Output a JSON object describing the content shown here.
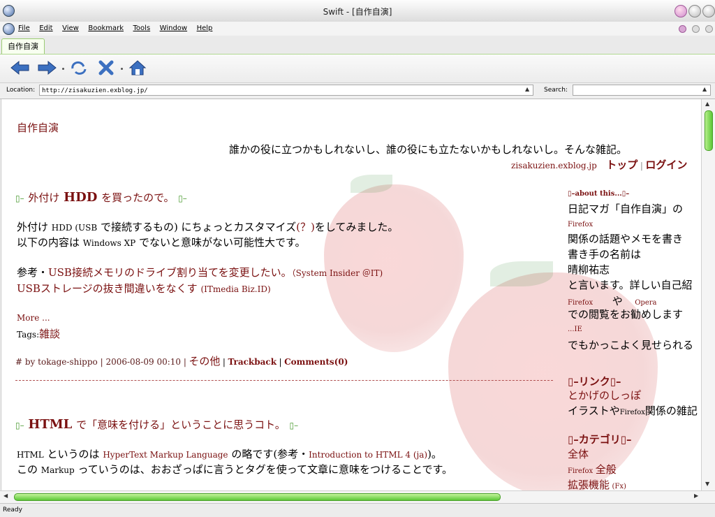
{
  "window": {
    "title": "Swift - [自作自演]"
  },
  "menu": [
    "File",
    "Edit",
    "View",
    "Bookmark",
    "Tools",
    "Window",
    "Help"
  ],
  "tabs": [
    {
      "label": "自作自演"
    }
  ],
  "location": {
    "label": "Location:",
    "value": "http://zisakuzien.exblog.jp/",
    "search_label": "Search:",
    "search_value": ""
  },
  "status": "Ready",
  "page": {
    "blog_title": "自作自演",
    "tagline": "誰かの役に立つかもしれないし、誰の役にも立たないかもしれないし。そんな雑記。",
    "domain": "zisakuzien.exblog.jp",
    "top_link": "トップ",
    "sep": "|",
    "login_link": "ログイン"
  },
  "post1": {
    "glyph_l": "▯–",
    "title_pre": "外付け",
    "title_bold": "HDD",
    "title_post": "を買ったので。",
    "glyph_r": "▯–",
    "line1_a": "外付け",
    "line1_b": "HDD (USB",
    "line1_c": "で接続するもの) にちょっとカスタマイズ",
    "line1_d": "(？)",
    "line1_e": "をしてみました。",
    "line2_a": "以下の内容は",
    "line2_b": "Windows XP",
    "line2_c": "でないと意味がない可能性大です。",
    "ref_label": "参考・",
    "ref1_a": "USB接続メモリのドライブ割り当てを変更したい。",
    "ref1_b": "（System Insider ＠IT)",
    "ref2_a": "USBストレージの抜き間違いをなくす",
    "ref2_b": "(ITmedia Biz.ID)",
    "more": "More ...",
    "tags_label": "Tags:",
    "tag": "雑談",
    "meta_by": "# by tokage-shippo | 2006-08-09 00:10 |",
    "meta_cat": "その他",
    "meta_sep1": "|",
    "trackback": "Trackback",
    "meta_sep2": "|",
    "comments": "Comments(0)"
  },
  "post2": {
    "glyph_l": "▯–",
    "title_bold": "HTML",
    "title_post": "で「意味を付ける」ということに思うコト。",
    "glyph_r": "▯–",
    "line1_a": "HTML",
    "line1_b": "というのは",
    "line1_c": "HyperText Markup Language",
    "line1_d": "の略です(参考・",
    "line1_e": "Introduction to HTML 4 (ja)",
    "line1_f": ")。",
    "line2_a": "この",
    "line2_b": "Markup",
    "line2_c": "っていうのは、おおざっぱに言うとタグを使って文章に意味をつけることです。"
  },
  "sidebar": {
    "about_head": "▯–about this...▯–",
    "about_l1": "日記マガ「自作自演」の",
    "firefox1": "Firefox",
    "about_l2": "関係の話題やメモを書き",
    "about_l3": "書き手の名前は",
    "about_l4": "晴柳祐志",
    "about_l5": "と言います。詳しい自己紹",
    "firefox2": "Firefox",
    "ya": "や",
    "opera": "Opera",
    "about_l6": "での閲覧をお勧めします",
    "ie": "...IE",
    "about_l7": "でもかっこよく見せられる",
    "link_head": "▯–リンク▯–",
    "link1": "とかげのしっぽ",
    "link1_desc_a": "イラストや",
    "link1_desc_b": "Firefox",
    "link1_desc_c": "関係の雑記",
    "cat_head": "▯–カテゴリ▯–",
    "cat1": "全体",
    "cat2_a": "Firefox",
    "cat2_b": "全般",
    "cat3_a": "拡張機能",
    "cat3_b": "(Fx)"
  },
  "colors": {
    "accent": "#7a1010",
    "tab_border": "#9ccc74",
    "scroll_green": "#5cc838"
  }
}
